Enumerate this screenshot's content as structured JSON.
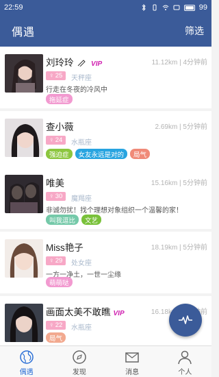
{
  "status": {
    "time": "22:59",
    "battery": "99"
  },
  "header": {
    "title": "偶遇",
    "filter": "筛选"
  },
  "cards": [
    {
      "name": "刘玲玲",
      "vip": "VIP",
      "meta": "11.12km | 4分钟前",
      "age": "25",
      "zodiac": "天秤座",
      "signature": "行走在冬夜的冷风中",
      "tags": [
        {
          "text": "拖延症",
          "color": "pink"
        }
      ]
    },
    {
      "name": "查小薇",
      "vip": "",
      "meta": "2.69km | 5分钟前",
      "age": "24",
      "zodiac": "水瓶座",
      "signature": "",
      "tags": [
        {
          "text": "强迫症",
          "color": "green"
        },
        {
          "text": "女友永远是对的",
          "color": "blue"
        },
        {
          "text": "局气",
          "color": "salmon"
        }
      ]
    },
    {
      "name": "唯美",
      "vip": "",
      "meta": "15.16km | 5分钟前",
      "age": "30",
      "zodiac": "魔羯座",
      "signature": "非诚勿扰！找个理想对象组织一个温馨的家！",
      "tags": [
        {
          "text": "叫我逗比",
          "color": "mint"
        },
        {
          "text": "文艺",
          "color": "lime"
        }
      ]
    },
    {
      "name": "Miss艳子",
      "vip": "",
      "meta": "18.19km | 5分钟前",
      "age": "29",
      "zodiac": "处女座",
      "signature": "一方一净土，一世一尘缘",
      "tags": [
        {
          "text": "萌萌哒",
          "color": "pink"
        }
      ]
    },
    {
      "name": "画面太美不敢瞧",
      "vip": "VIP",
      "meta": "16.18km | 5分钟前",
      "age": "22",
      "zodiac": "水瓶座",
      "signature": "",
      "tags": [
        {
          "text": "局气",
          "color": "orange"
        }
      ]
    }
  ],
  "tabs": [
    {
      "label": "偶遇",
      "icon": "globe-icon",
      "active": true
    },
    {
      "label": "发现",
      "icon": "compass-icon",
      "active": false
    },
    {
      "label": "消息",
      "icon": "mail-icon",
      "active": false
    },
    {
      "label": "个人",
      "icon": "person-icon",
      "active": false
    }
  ]
}
